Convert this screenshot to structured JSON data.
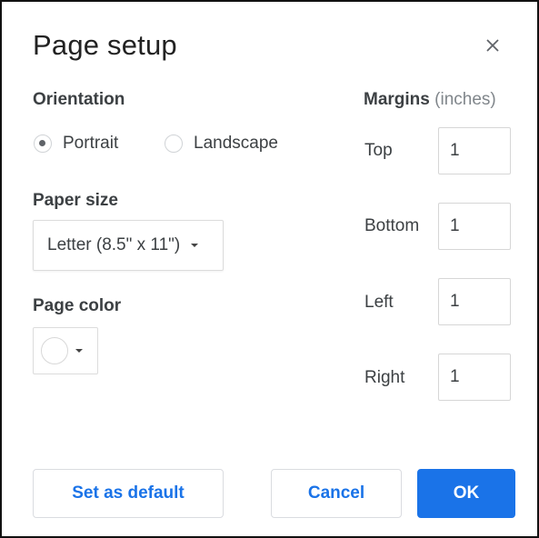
{
  "dialog": {
    "title": "Page setup",
    "close_icon": "close-icon"
  },
  "orientation": {
    "label": "Orientation",
    "options": [
      {
        "label": "Portrait",
        "selected": true
      },
      {
        "label": "Landscape",
        "selected": false
      }
    ]
  },
  "paper_size": {
    "label": "Paper size",
    "value": "Letter (8.5\" x 11\")"
  },
  "page_color": {
    "label": "Page color",
    "value": "#ffffff"
  },
  "margins": {
    "label": "Margins",
    "unit": "(inches)",
    "top": {
      "label": "Top",
      "value": "1"
    },
    "bottom": {
      "label": "Bottom",
      "value": "1"
    },
    "left": {
      "label": "Left",
      "value": "1"
    },
    "right": {
      "label": "Right",
      "value": "1"
    }
  },
  "buttons": {
    "set_default": "Set as default",
    "cancel": "Cancel",
    "ok": "OK"
  },
  "colors": {
    "accent": "#1a73e8",
    "text": "#3c4043",
    "muted": "#80868b"
  }
}
